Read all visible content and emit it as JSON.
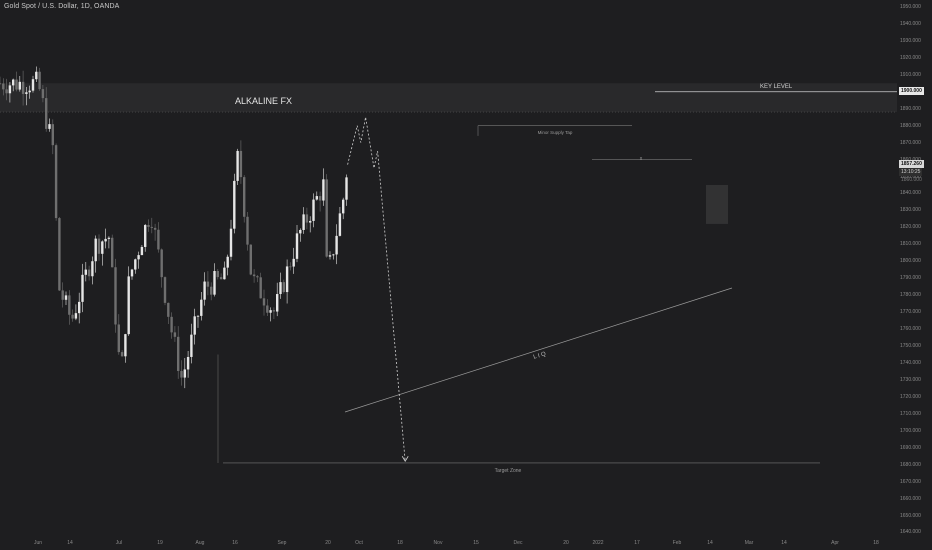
{
  "header": {
    "symbol_title": "Gold Spot / U.S. Dollar, 1D, OANDA"
  },
  "price_axis": {
    "labels": [
      "1950.000",
      "1940.000",
      "1930.000",
      "1920.000",
      "1910.000",
      "1900.000",
      "1890.000",
      "1880.000",
      "1870.000",
      "1860.000",
      "1850.000",
      "1840.000",
      "1830.000",
      "1820.000",
      "1810.000",
      "1800.000",
      "1790.000",
      "1780.000",
      "1770.000",
      "1760.000",
      "1750.000",
      "1740.000",
      "1730.000",
      "1720.000",
      "1710.000",
      "1700.000",
      "1690.000",
      "1680.000",
      "1670.000",
      "1660.000",
      "1650.000",
      "1640.000"
    ],
    "key_level_badge": "1900.000",
    "last_price_badge": "1857.260",
    "countdown_badge": "13:10:25",
    "sub_badge": "1860.000"
  },
  "time_axis": {
    "labels": [
      "Jun",
      "14",
      "Jul",
      "19",
      "Aug",
      "16",
      "Sep",
      "20",
      "Oct",
      "18",
      "Nov",
      "15",
      "Dec",
      "20",
      "2022",
      "17",
      "Feb",
      "14",
      "Mar",
      "14",
      "Apr",
      "18"
    ]
  },
  "drawings": {
    "watermark": "ALKALINE FX",
    "key_level": "KEY LEVEL",
    "minor_supply": "Minor Supply Tap",
    "x_marker": "x",
    "liq": "L I Q",
    "target": "Target Zone"
  },
  "colors": {
    "background": "#1e1e20",
    "candle_up": "#e6e6e6",
    "candle_down": "#6f6f6f",
    "annotation": "#9a9a9a",
    "key_level_band": "#2a2a2c"
  },
  "chart_data": {
    "type": "candlestick",
    "symbol": "XAUUSD",
    "timeframe": "1D",
    "ylim": [
      1640,
      1955
    ],
    "grid": false,
    "approx_close_path": [
      {
        "date": "2021-06-01",
        "close": 1905
      },
      {
        "date": "2021-06-14",
        "close": 1865
      },
      {
        "date": "2021-06-18",
        "close": 1785
      },
      {
        "date": "2021-06-29",
        "close": 1765
      },
      {
        "date": "2021-07-19",
        "close": 1810
      },
      {
        "date": "2021-07-30",
        "close": 1815
      },
      {
        "date": "2021-08-09",
        "close": 1730
      },
      {
        "date": "2021-08-16",
        "close": 1790
      },
      {
        "date": "2021-09-03",
        "close": 1830
      },
      {
        "date": "2021-09-20",
        "close": 1760
      },
      {
        "date": "2021-09-29",
        "close": 1730
      },
      {
        "date": "2021-10-18",
        "close": 1785
      },
      {
        "date": "2021-11-04",
        "close": 1790
      },
      {
        "date": "2021-11-15",
        "close": 1865
      },
      {
        "date": "2021-11-26",
        "close": 1790
      },
      {
        "date": "2021-12-15",
        "close": 1770
      },
      {
        "date": "2022-01-04",
        "close": 1815
      },
      {
        "date": "2022-01-25",
        "close": 1845
      },
      {
        "date": "2022-01-28",
        "close": 1790
      },
      {
        "date": "2022-02-10",
        "close": 1835
      },
      {
        "date": "2022-02-14",
        "close": 1857.26
      }
    ],
    "projection": [
      {
        "date": "2022-02-14",
        "price": 1857
      },
      {
        "date": "2022-02-22",
        "price": 1880
      },
      {
        "date": "2022-02-25",
        "price": 1870
      },
      {
        "date": "2022-03-01",
        "price": 1885
      },
      {
        "date": "2022-03-08",
        "price": 1855
      },
      {
        "date": "2022-03-11",
        "price": 1865
      },
      {
        "date": "2022-04-03",
        "price": 1682
      }
    ],
    "levels": {
      "key_level": 1900,
      "minor_supply_tap": 1880,
      "x_level": 1860,
      "target_zone": 1681
    }
  }
}
